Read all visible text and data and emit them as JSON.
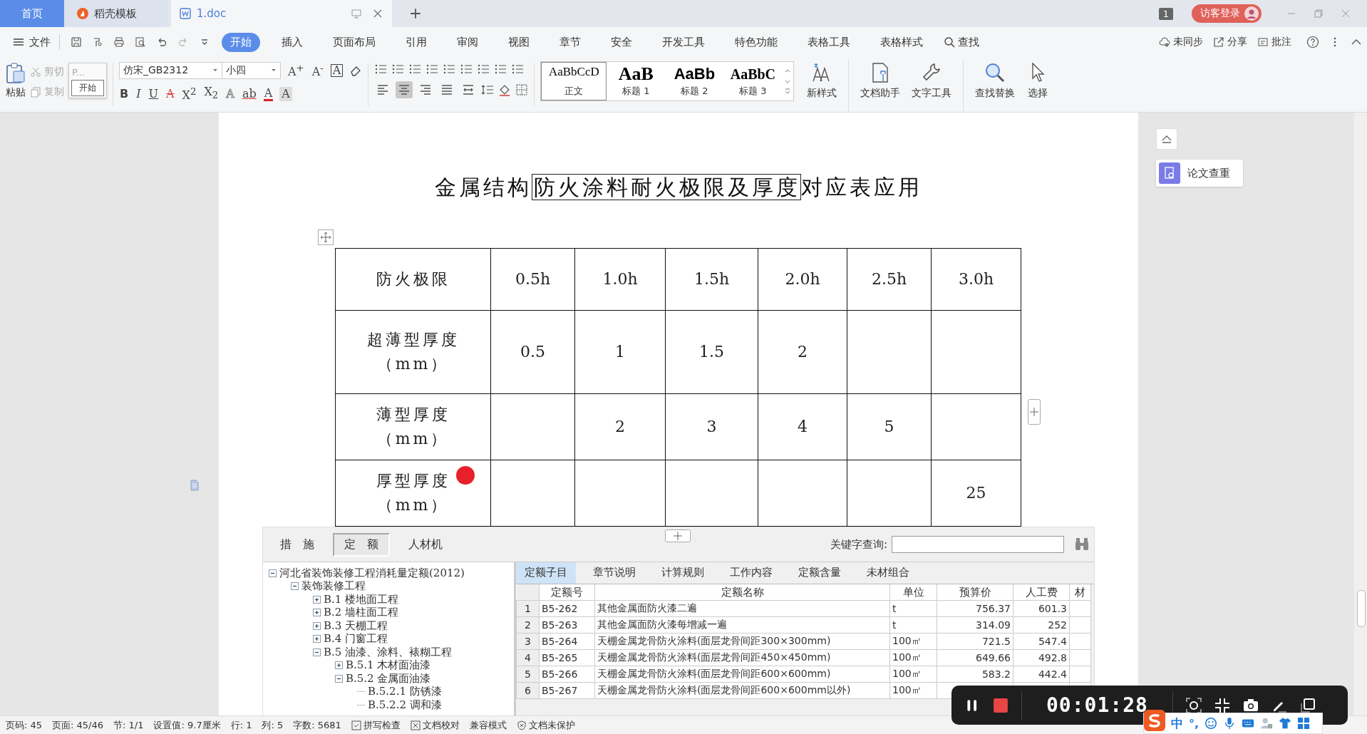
{
  "tabs": [
    {
      "label": "首页",
      "kind": "home",
      "selected": false
    },
    {
      "label": "稻壳模板",
      "kind": "template",
      "selected": false
    },
    {
      "label": "1.doc",
      "kind": "doc",
      "selected": true
    }
  ],
  "title_bar": {
    "badge": "1",
    "login": "访客登录"
  },
  "menu": {
    "file": "文件",
    "tabs": [
      {
        "label": "开始",
        "selected": true
      },
      {
        "label": "插入",
        "selected": false
      },
      {
        "label": "页面布局",
        "selected": false
      },
      {
        "label": "引用",
        "selected": false
      },
      {
        "label": "审阅",
        "selected": false
      },
      {
        "label": "视图",
        "selected": false
      },
      {
        "label": "章节",
        "selected": false
      },
      {
        "label": "安全",
        "selected": false
      },
      {
        "label": "开发工具",
        "selected": false
      },
      {
        "label": "特色功能",
        "selected": false
      },
      {
        "label": "表格工具",
        "selected": false
      },
      {
        "label": "表格样式",
        "selected": false
      }
    ],
    "search": "查找",
    "actions": [
      {
        "label": "未同步",
        "kind": "cloud"
      },
      {
        "label": "分享",
        "kind": "share"
      },
      {
        "label": "批注",
        "kind": "comment"
      }
    ]
  },
  "ribbon": {
    "paste": "粘贴",
    "cut": "剪切",
    "copy": "复制",
    "tooltip": {
      "title": "P...",
      "text": "开始"
    },
    "font": "仿宋_GB2312",
    "size": "小四",
    "format_top": [
      {
        "glyph": "A$^{+}$",
        "kind": "plain"
      },
      {
        "glyph": "A$^{-}$",
        "kind": "plain"
      },
      {
        "glyph": "A",
        "kind": "boxed"
      }
    ],
    "format_bottom": [
      {
        "glyph": "B",
        "kind": "bold"
      },
      {
        "glyph": "I",
        "kind": "italic"
      },
      {
        "glyph": "U",
        "kind": "underline"
      },
      {
        "glyph": "A",
        "kind": "strike"
      },
      {
        "glyph": "X$^{2}$",
        "kind": "plain"
      },
      {
        "glyph": "X$_{2}$",
        "kind": "plain"
      },
      {
        "glyph": "A",
        "kind": "outline"
      },
      {
        "glyph": "ab",
        "kind": "highlight"
      },
      {
        "glyph": "A",
        "kind": "color"
      },
      {
        "glyph": "A",
        "kind": "shaded"
      }
    ],
    "align": [
      {
        "kind": "left",
        "selected": false
      },
      {
        "kind": "center",
        "selected": true
      },
      {
        "kind": "right",
        "selected": false
      },
      {
        "kind": "justify",
        "selected": false
      },
      {
        "kind": "distribute",
        "selected": false
      }
    ],
    "styles": [
      {
        "preview": "AaBbCcD",
        "label": "正文",
        "kind": "body",
        "selected": true
      },
      {
        "preview": "AaB",
        "label": "标题 1",
        "kind": "h1",
        "selected": false
      },
      {
        "preview": "AaBb",
        "label": "标题 2",
        "kind": "h2",
        "selected": false
      },
      {
        "preview": "AaBbC",
        "label": "标题 3",
        "kind": "h3",
        "selected": false
      }
    ],
    "tools": [
      {
        "label": "新样式",
        "kind": "newstyle"
      },
      {
        "label": "文档助手",
        "kind": "assistant"
      },
      {
        "label": "文字工具",
        "kind": "wrench"
      },
      {
        "label": "查找替换",
        "kind": "find"
      },
      {
        "label": "选择",
        "kind": "select"
      }
    ]
  },
  "document": {
    "title": [
      {
        "text": "金属结构",
        "boxed": false
      },
      {
        "text": "防火涂料耐火极限及厚度",
        "boxed": true
      },
      {
        "text": "对应表应用",
        "boxed": false
      }
    ],
    "table": {
      "rows": [
        [
          [
            "防火极限"
          ],
          [
            "0.5h"
          ],
          [
            "1.0h"
          ],
          [
            "1.5h"
          ],
          [
            "2.0h"
          ],
          [
            "2.5h"
          ],
          [
            "3.0h"
          ]
        ],
        [
          [
            "超薄型厚度",
            "（mm）"
          ],
          [
            "0.5"
          ],
          [
            "1"
          ],
          [
            "1.5"
          ],
          [
            "2"
          ],
          [],
          []
        ],
        [
          [
            "薄型厚度",
            "（mm）"
          ],
          [],
          [
            "2"
          ],
          [
            "3"
          ],
          [
            "4"
          ],
          [
            "5"
          ],
          []
        ],
        [
          [
            "厚型厚度",
            "（mm）"
          ],
          [],
          [],
          [],
          [],
          [],
          [
            "25"
          ]
        ]
      ]
    }
  },
  "embedded": {
    "tabs": [
      {
        "label": "措　施",
        "selected": false
      },
      {
        "label": "定　额",
        "selected": true
      },
      {
        "label": "人材机",
        "selected": false
      }
    ],
    "search_label": "关键字查询:",
    "tree": [
      {
        "label": "河北省装饰装修工程消耗量定额(2012)",
        "kind": "folder",
        "expanded": true,
        "children": [
          {
            "label": "装饰装修工程",
            "kind": "folder",
            "expanded": true,
            "children": [
              {
                "label": "B.1 楼地面工程",
                "kind": "folder",
                "expanded": false
              },
              {
                "label": "B.2 墙柱面工程",
                "kind": "folder",
                "expanded": false
              },
              {
                "label": "B.3 天棚工程",
                "kind": "folder",
                "expanded": false
              },
              {
                "label": "B.4 门窗工程",
                "kind": "folder",
                "expanded": false
              },
              {
                "label": "B.5 油漆、涂料、裱糊工程",
                "kind": "folder",
                "expanded": true,
                "children": [
                  {
                    "label": "B.5.1 木材面油漆",
                    "kind": "folder",
                    "expanded": false
                  },
                  {
                    "label": "B.5.2 金属面油漆",
                    "kind": "folder",
                    "expanded": true,
                    "children": [
                      {
                        "label": "B.5.2.1 防锈漆",
                        "kind": "leaf"
                      },
                      {
                        "label": "B.5.2.2 调和漆",
                        "kind": "leaf"
                      }
                    ]
                  }
                ]
              }
            ]
          }
        ]
      }
    ],
    "subtabs": [
      {
        "label": "定额子目",
        "selected": true
      },
      {
        "label": "章节说明",
        "selected": false
      },
      {
        "label": "计算规则",
        "selected": false
      },
      {
        "label": "工作内容",
        "selected": false
      },
      {
        "label": "定额含量",
        "selected": false
      },
      {
        "label": "未材组合",
        "selected": false
      }
    ],
    "columns": [
      "定额号",
      "定额名称",
      "单位",
      "预算价",
      "人工费",
      "材"
    ],
    "rows": [
      {
        "num": "1",
        "code": "B5-262",
        "name": "其他金属面防火漆二遍",
        "unit": "t",
        "price": "756.37",
        "labor": "601.3"
      },
      {
        "num": "2",
        "code": "B5-263",
        "name": "其他金属面防火漆每增减一遍",
        "unit": "t",
        "price": "314.09",
        "labor": "252"
      },
      {
        "num": "3",
        "code": "B5-264",
        "name": "天棚金属龙骨防火涂料(面层龙骨间距300×300mm)",
        "unit": "100㎡",
        "price": "721.5",
        "labor": "547.4"
      },
      {
        "num": "4",
        "code": "B5-265",
        "name": "天棚金属龙骨防火涂料(面层龙骨间距450×450mm)",
        "unit": "100㎡",
        "price": "649.66",
        "labor": "492.8"
      },
      {
        "num": "5",
        "code": "B5-266",
        "name": "天棚金属龙骨防火涂料(面层龙骨间距600×600mm)",
        "unit": "100㎡",
        "price": "583.2",
        "labor": "442.4"
      },
      {
        "num": "6",
        "code": "B5-267",
        "name": "天棚金属龙骨防火涂料(面层龙骨间距600×600mm以外)",
        "unit": "100㎡"
      }
    ]
  },
  "side_panel": {
    "button": "论文查重"
  },
  "status_bar": [
    {
      "text": "页码: 45",
      "kind": "text"
    },
    {
      "text": "页面: 45/46",
      "kind": "text"
    },
    {
      "text": "节: 1/1",
      "kind": "text"
    },
    {
      "text": "设置值: 9.7厘米",
      "kind": "text"
    },
    {
      "text": "行: 1",
      "kind": "text"
    },
    {
      "text": "列: 5",
      "kind": "text"
    },
    {
      "text": "字数: 5681",
      "kind": "text"
    },
    {
      "text": "拼写检查",
      "kind": "spell"
    },
    {
      "text": "文档校对",
      "kind": "proof"
    },
    {
      "text": "兼容模式",
      "kind": "text"
    },
    {
      "text": "文档未保护",
      "kind": "shield"
    }
  ],
  "recorder": {
    "time": "00:01:28"
  },
  "ime": {
    "mode": "中",
    "punct": "°,"
  }
}
